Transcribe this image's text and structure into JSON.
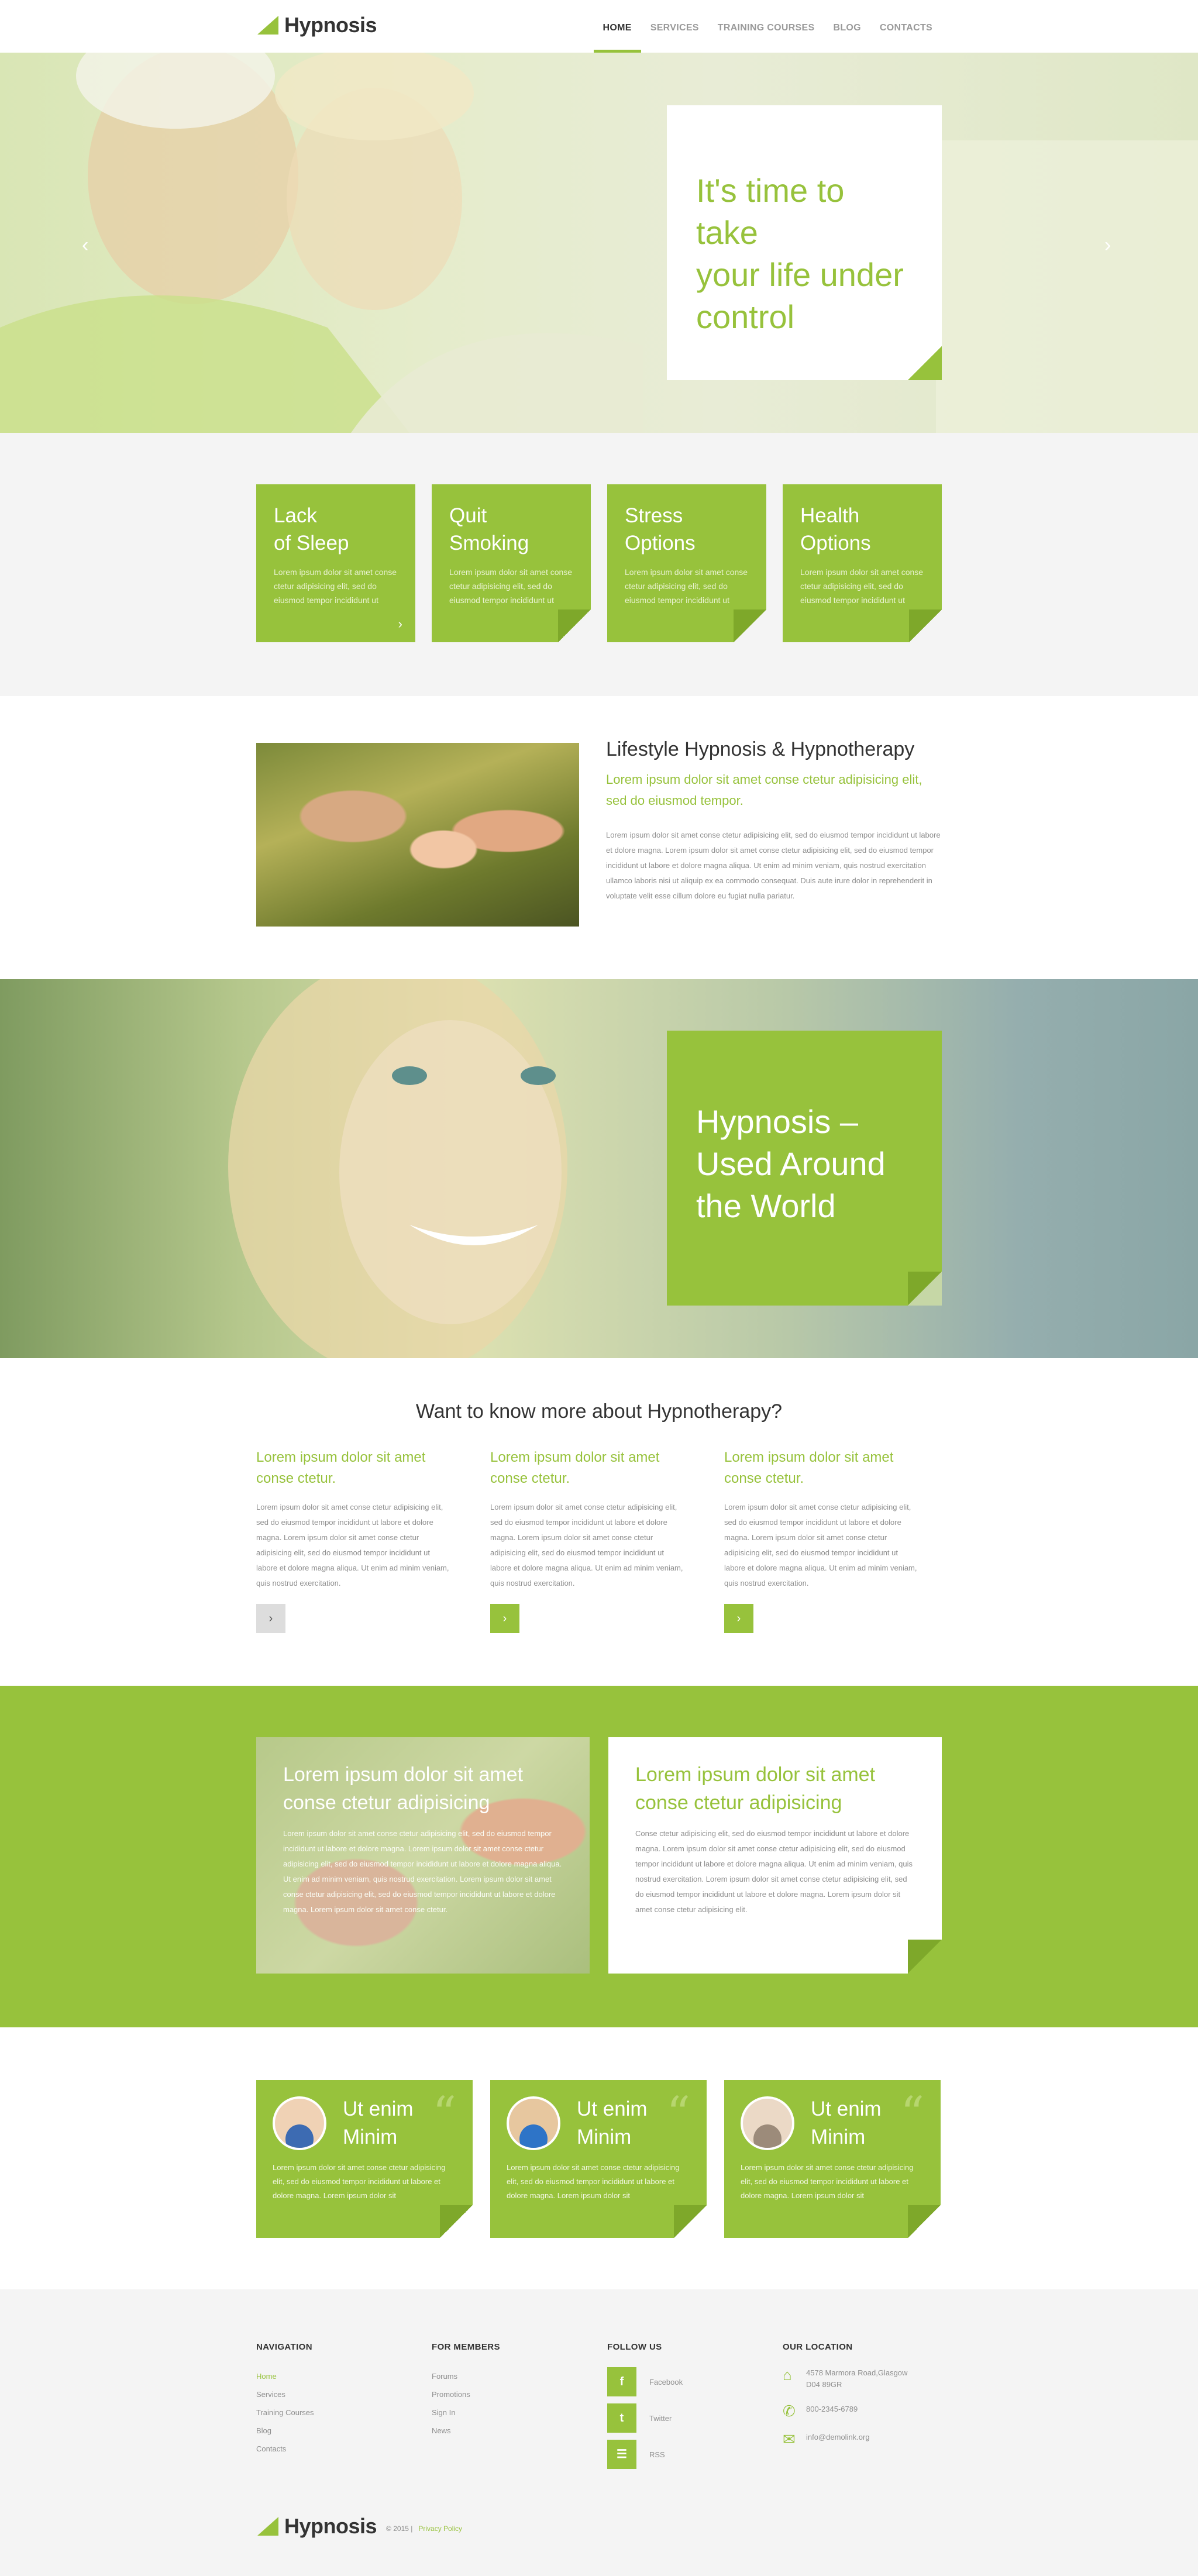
{
  "brand": {
    "name": "Hypnosis",
    "accent": "#97c23c"
  },
  "nav": {
    "items": [
      {
        "label": "HOME",
        "active": true
      },
      {
        "label": "SERVICES",
        "active": false
      },
      {
        "label": "TRAINING COURSES",
        "active": false
      },
      {
        "label": "BLOG",
        "active": false
      },
      {
        "label": "CONTACTS",
        "active": false
      }
    ]
  },
  "hero": {
    "title_line1": "It's time to take",
    "title_line2": "your life under",
    "title_line3": "control",
    "prev_icon": "chevron-left-icon",
    "next_icon": "chevron-right-icon"
  },
  "features": [
    {
      "title_line1": "Lack",
      "title_line2": "of Sleep",
      "text": "Lorem ipsum dolor sit amet conse ctetur adipisicing elit, sed do eiusmod tempor incididunt ut",
      "has_arrow": true
    },
    {
      "title_line1": "Quit",
      "title_line2": "Smoking",
      "text": "Lorem ipsum dolor sit amet conse ctetur adipisicing elit, sed do eiusmod tempor incididunt ut",
      "has_arrow": false
    },
    {
      "title_line1": "Stress",
      "title_line2": "Options",
      "text": "Lorem ipsum dolor sit amet conse ctetur adipisicing elit, sed do eiusmod tempor incididunt ut",
      "has_arrow": false
    },
    {
      "title_line1": "Health",
      "title_line2": "Options",
      "text": "Lorem ipsum dolor sit amet conse ctetur adipisicing elit, sed do eiusmod tempor incididunt ut",
      "has_arrow": false
    }
  ],
  "lifestyle": {
    "heading": "Lifestyle Hypnosis & Hypnotherapy",
    "lead": "Lorem ipsum dolor sit amet conse ctetur adipisicing elit, sed do eiusmod tempor.",
    "body": "Lorem ipsum dolor sit amet conse ctetur adipisicing elit, sed do eiusmod tempor incididunt ut labore et dolore magna. Lorem ipsum dolor sit amet conse ctetur adipisicing elit, sed do eiusmod tempor incididunt ut labore et dolore magna aliqua. Ut enim ad minim veniam, quis nostrud exercitation ullamco laboris nisi ut aliquip ex ea commodo consequat. Duis aute irure dolor in reprehenderit in voluptate velit esse cillum dolore eu fugiat nulla pariatur."
  },
  "banner2": {
    "title_line1": "Hypnosis –",
    "title_line2": "Used Around",
    "title_line3": "the World"
  },
  "more": {
    "heading": "Want to know more about Hypnotherapy?",
    "columns": [
      {
        "title_line1": "Lorem ipsum dolor sit amet",
        "title_line2": "conse ctetur.",
        "text": "Lorem ipsum dolor sit amet conse ctetur adipisicing elit, sed do eiusmod tempor incididunt ut labore et dolore magna. Lorem ipsum dolor sit amet conse ctetur adipisicing elit, sed do eiusmod tempor incididunt ut labore et dolore magna aliqua. Ut enim ad minim veniam, quis nostrud exercitation."
      },
      {
        "title_line1": "Lorem ipsum dolor sit amet",
        "title_line2": "conse ctetur.",
        "text": "Lorem ipsum dolor sit amet conse ctetur adipisicing elit, sed do eiusmod tempor incididunt ut labore et dolore magna. Lorem ipsum dolor sit amet conse ctetur adipisicing elit, sed do eiusmod tempor incididunt ut labore et dolore magna aliqua. Ut enim ad minim veniam, quis nostrud exercitation."
      },
      {
        "title_line1": "Lorem ipsum dolor sit amet",
        "title_line2": "conse ctetur.",
        "text": "Lorem ipsum dolor sit amet conse ctetur adipisicing elit, sed do eiusmod tempor incididunt ut labore et dolore magna. Lorem ipsum dolor sit amet conse ctetur adipisicing elit, sed do eiusmod tempor incididunt ut labore et dolore magna aliqua. Ut enim ad minim veniam, quis nostrud exercitation."
      }
    ]
  },
  "green": {
    "photo_title_line1": "Lorem ipsum dolor sit amet",
    "photo_title_line2": "conse ctetur adipisicing",
    "photo_text": "Lorem ipsum dolor sit amet conse ctetur adipisicing elit, sed do eiusmod tempor incididunt ut labore et dolore magna. Lorem ipsum dolor sit amet conse ctetur adipisicing elit, sed do eiusmod tempor incididunt ut labore et dolore magna aliqua. Ut enim ad minim veniam, quis nostrud exercitation. Lorem ipsum dolor sit amet conse ctetur adipisicing elit, sed do eiusmod tempor incididunt ut labore et dolore magna. Lorem ipsum dolor sit amet conse ctetur.",
    "card_title_line1": "Lorem ipsum dolor sit amet",
    "card_title_line2": "conse ctetur adipisicing",
    "card_text": "Conse ctetur adipisicing elit, sed do eiusmod tempor incididunt ut labore et dolore magna. Lorem ipsum dolor sit amet conse ctetur adipisicing elit, sed do eiusmod tempor incididunt ut labore et dolore magna aliqua. Ut enim ad minim veniam, quis nostrud exercitation. Lorem ipsum dolor sit amet conse ctetur adipisicing elit, sed do eiusmod tempor incididunt ut labore et dolore magna. Lorem ipsum dolor sit amet conse ctetur adipisicing elit."
  },
  "testimonials": [
    {
      "title_line1": "Ut enim",
      "title_line2": "Minim",
      "text": "Lorem ipsum dolor sit amet conse ctetur adipisicing elit, sed do eiusmod tempor incididunt ut labore et dolore magna. Lorem ipsum dolor sit"
    },
    {
      "title_line1": "Ut enim",
      "title_line2": "Minim",
      "text": "Lorem ipsum dolor sit amet conse ctetur adipisicing elit, sed do eiusmod tempor incididunt ut labore et dolore magna. Lorem ipsum dolor sit"
    },
    {
      "title_line1": "Ut enim",
      "title_line2": "Minim",
      "text": "Lorem ipsum dolor sit amet conse ctetur adipisicing elit, sed do eiusmod tempor incididunt ut labore et dolore magna. Lorem ipsum dolor sit"
    }
  ],
  "footer": {
    "navigation": {
      "heading": "NAVIGATION",
      "links": [
        "Home",
        "Services",
        "Training Courses",
        "Blog",
        "Contacts"
      ]
    },
    "members": {
      "heading": "FOR MEMBERS",
      "links": [
        "Forums",
        "Promotions",
        "Sign In",
        "News"
      ]
    },
    "follow": {
      "heading": "FOLLOW US",
      "items": [
        {
          "label": "Facebook",
          "glyph": "f"
        },
        {
          "label": "Twitter",
          "glyph": "t"
        },
        {
          "label": "RSS",
          "glyph": "☰"
        }
      ]
    },
    "location": {
      "heading": "OUR LOCATION",
      "address": "4578 Marmora Road,Glasgow D04 89GR",
      "phone": "800-2345-6789",
      "email": "info@demolink.org"
    },
    "copyright": "© 2015 |",
    "privacy": "Privacy Policy"
  }
}
